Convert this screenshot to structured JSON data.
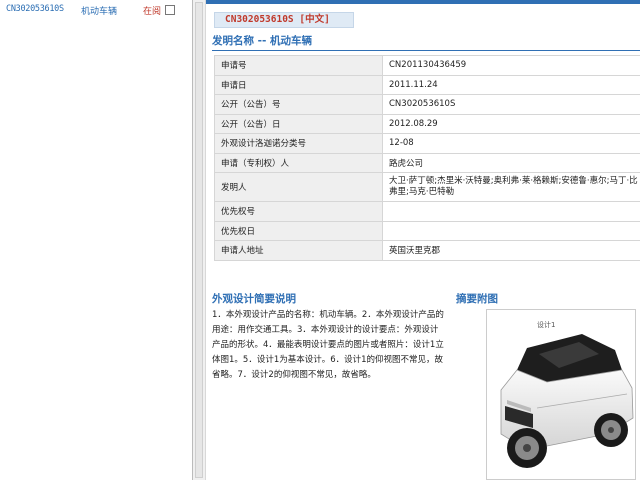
{
  "left_panel": {
    "entry_number": "CN302053610S",
    "entry_name": "机动车辆",
    "status": "在阅"
  },
  "main": {
    "doc_tab": "CN302053610S [中文]",
    "section_title": "发明名称 -- 机动车辆",
    "fields": [
      {
        "label": "申请号",
        "value": "CN201130436459"
      },
      {
        "label": "申请日",
        "value": "2011.11.24"
      },
      {
        "label": "公开（公告）号",
        "value": "CN302053610S"
      },
      {
        "label": "公开（公告）日",
        "value": "2012.08.29"
      },
      {
        "label": "外观设计洛迦诺分类号",
        "value": "12-08"
      },
      {
        "label": "申请（专利权）人",
        "value": "路虎公司"
      },
      {
        "label": "发明人",
        "value": "大卫·萨丁顿;杰里米·沃特曼;奥利弗·莱·格赖斯;安德鲁·惠尔;马丁·比弗里;马克·巴特勒"
      },
      {
        "label": "优先权号",
        "value": ""
      },
      {
        "label": "优先权日",
        "value": ""
      },
      {
        "label": "申请人地址",
        "value": "英国沃里克郡"
      }
    ],
    "desc_title": "外观设计简要说明",
    "desc_text": "1．本外观设计产品的名称：机动车辆。2．本外观设计产品的用途：用作交通工具。3．本外观设计的设计要点：外观设计产品的形状。4．最能表明设计要点的图片或者照片：设计1立体图1。5．设计1为基本设计。6．设计1的仰视图不常见，故省略。7．设计2的仰视图不常见，故省略。",
    "abstract_title": "摘要附图",
    "image_label": "设计1",
    "colors": {
      "accent": "#2f6fb4",
      "docid": "#c0392b"
    }
  }
}
